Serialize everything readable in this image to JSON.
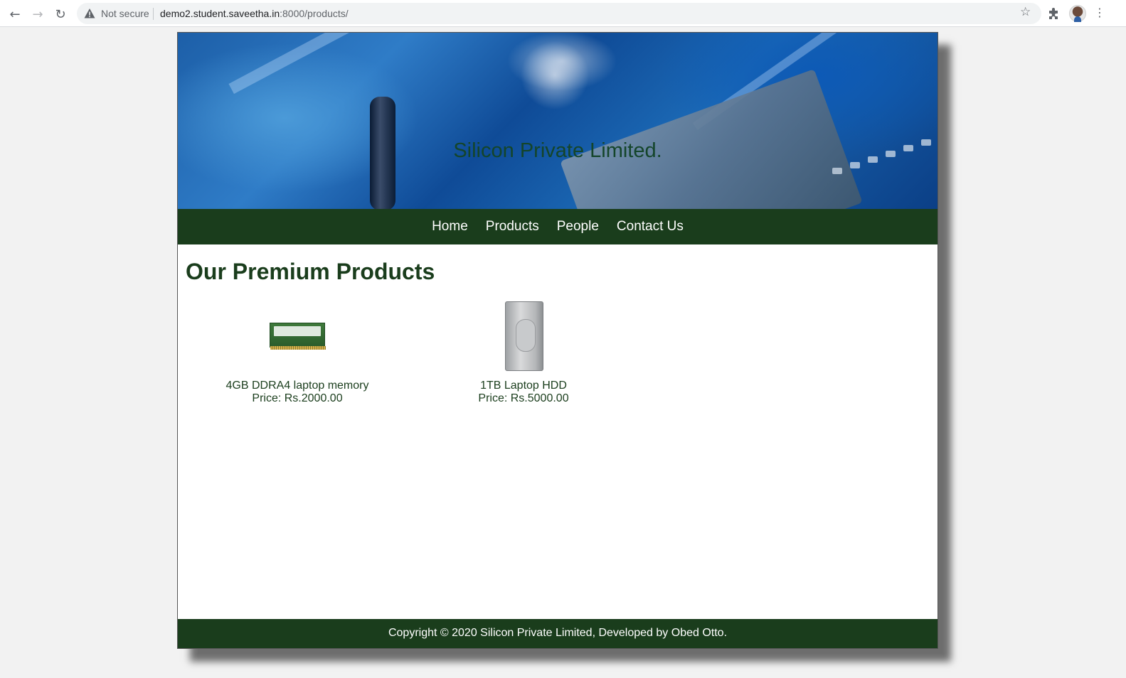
{
  "browser": {
    "security_label": "Not secure",
    "url_host": "demo2.student.saveetha.in",
    "url_path": ":8000/products/"
  },
  "site": {
    "title": "Silicon Private Limited."
  },
  "nav": {
    "items": [
      {
        "label": "Home"
      },
      {
        "label": "Products"
      },
      {
        "label": "People"
      },
      {
        "label": "Contact Us"
      }
    ]
  },
  "main": {
    "heading": "Our Premium Products",
    "products": [
      {
        "name": "4GB DDRA4 laptop memory",
        "price": "Price: Rs.2000.00"
      },
      {
        "name": "1TB Laptop HDD",
        "price": "Price: Rs.5000.00"
      }
    ]
  },
  "footer": {
    "text": "Copyright © 2020 Silicon Private Limited, Developed by Obed Otto."
  }
}
